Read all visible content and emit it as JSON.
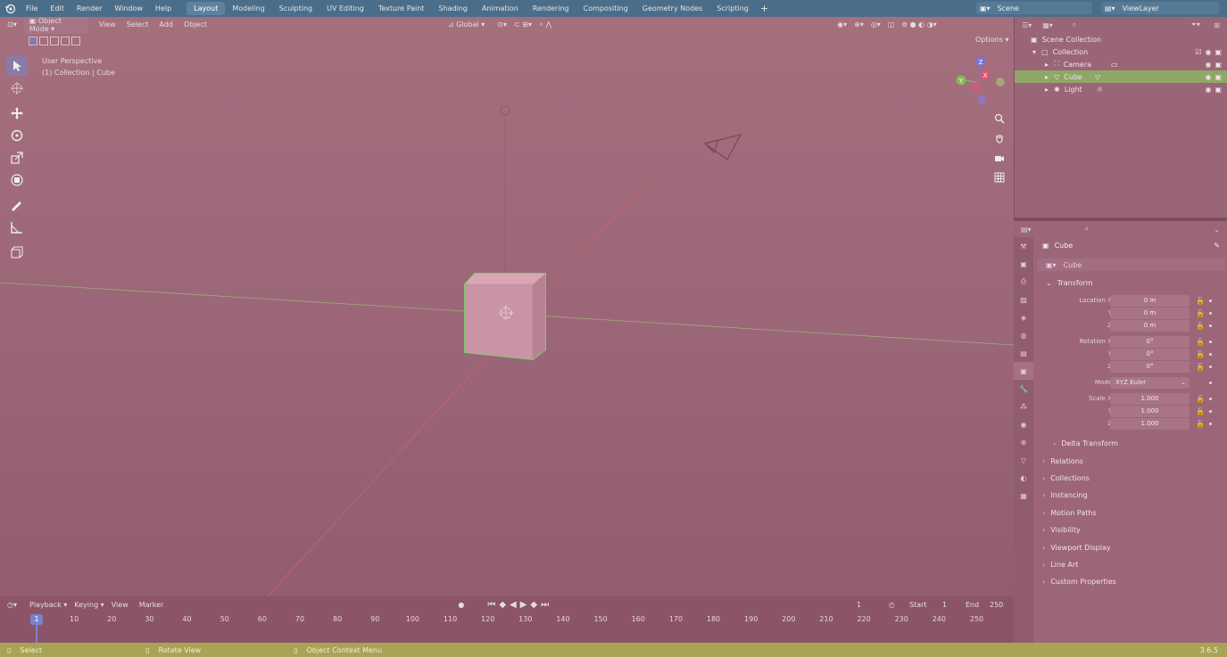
{
  "menu": [
    "File",
    "Edit",
    "Render",
    "Window",
    "Help"
  ],
  "workspaces": [
    "Layout",
    "Modeling",
    "Sculpting",
    "UV Editing",
    "Texture Paint",
    "Shading",
    "Animation",
    "Rendering",
    "Compositing",
    "Geometry Nodes",
    "Scripting"
  ],
  "active_workspace": "Layout",
  "scene": {
    "label": "Scene"
  },
  "viewlayer": {
    "label": "ViewLayer"
  },
  "viewport": {
    "mode": "Object Mode",
    "menus": [
      "View",
      "Select",
      "Add",
      "Object"
    ],
    "transform_orientation": "Global",
    "options_label": "Options",
    "hud_line1": "User Perspective",
    "hud_line2": "(1) Collection | Cube"
  },
  "outliner": {
    "root": "Scene Collection",
    "collection": "Collection",
    "items": [
      {
        "name": "Camera",
        "selected": false
      },
      {
        "name": "Cube",
        "selected": true
      },
      {
        "name": "Light",
        "selected": false
      }
    ]
  },
  "properties": {
    "object_name": "Cube",
    "data_name": "Cube",
    "transform_label": "Transform",
    "location": {
      "label": "Location X",
      "x": "0 m",
      "y": "0 m",
      "z": "0 m"
    },
    "rotation": {
      "label": "Rotation X",
      "x": "0°",
      "y": "0°",
      "z": "0°"
    },
    "mode": {
      "label": "Mode",
      "value": "XYZ Euler"
    },
    "scale": {
      "label": "Scale X",
      "x": "1.000",
      "y": "1.000",
      "z": "1.000"
    },
    "axis_y": "Y",
    "axis_z": "Z",
    "sections": [
      "Delta Transform",
      "Relations",
      "Collections",
      "Instancing",
      "Motion Paths",
      "Visibility",
      "Viewport Display",
      "Line Art",
      "Custom Properties"
    ]
  },
  "timeline": {
    "menus": [
      "Playback",
      "Keying",
      "View",
      "Marker"
    ],
    "current_frame": "1",
    "start_label": "Start",
    "start": "1",
    "end_label": "End",
    "end": "250",
    "ticks": [
      "10",
      "20",
      "30",
      "40",
      "50",
      "60",
      "70",
      "80",
      "90",
      "100",
      "110",
      "120",
      "130",
      "140",
      "150",
      "160",
      "170",
      "180",
      "190",
      "200",
      "210",
      "220",
      "230",
      "240",
      "250"
    ]
  },
  "statusbar": {
    "select": "Select",
    "rotate": "Rotate View",
    "context": "Object Context Menu",
    "version": "3.6.5"
  },
  "colors": {
    "accent": "#4a6e8a",
    "selection": "#8fa766",
    "active_object_outline": "#76d06a"
  }
}
